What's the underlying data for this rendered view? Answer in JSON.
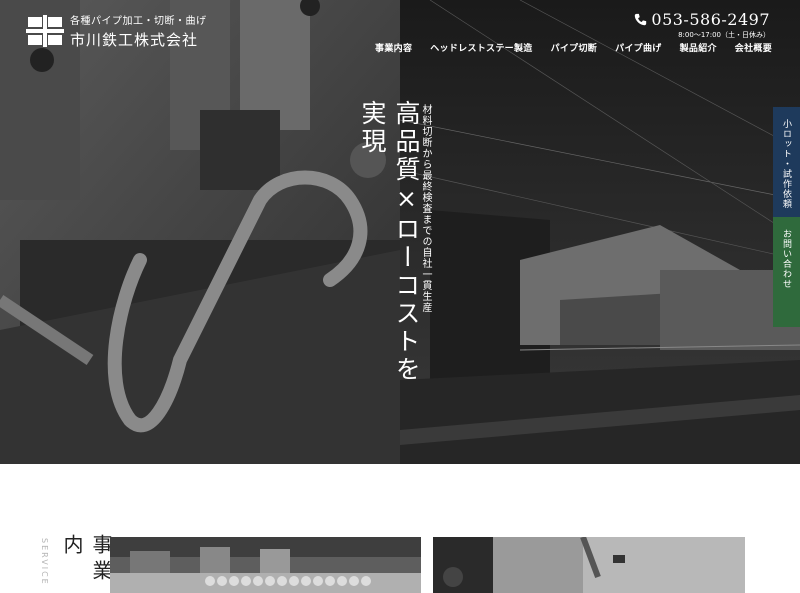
{
  "header": {
    "logo_sub": "各種パイプ加工・切断・曲げ",
    "company_name": "市川鉄工株式会社",
    "phone": "053-586-2497",
    "hours": "8:00～17:00（土・日休み）"
  },
  "nav": {
    "items": [
      {
        "label": "事業内容"
      },
      {
        "label": "ヘッドレストステー製造"
      },
      {
        "label": "パイプ切断"
      },
      {
        "label": "パイプ曲げ"
      },
      {
        "label": "製品紹介"
      },
      {
        "label": "会社概要"
      }
    ]
  },
  "hero": {
    "catch_main": "高品質×ローコストを実現",
    "catch_sub": "材料切断から最終検査までの自社一貫生産"
  },
  "side_tabs": {
    "lot_request": "小ロット・試作依頼",
    "contact": "お問い合わせ"
  },
  "service": {
    "en": "SERVICE",
    "ja": "事業内"
  },
  "colors": {
    "side_tab_blue": "#1e3a5c",
    "side_tab_green": "#2f6a3c"
  }
}
